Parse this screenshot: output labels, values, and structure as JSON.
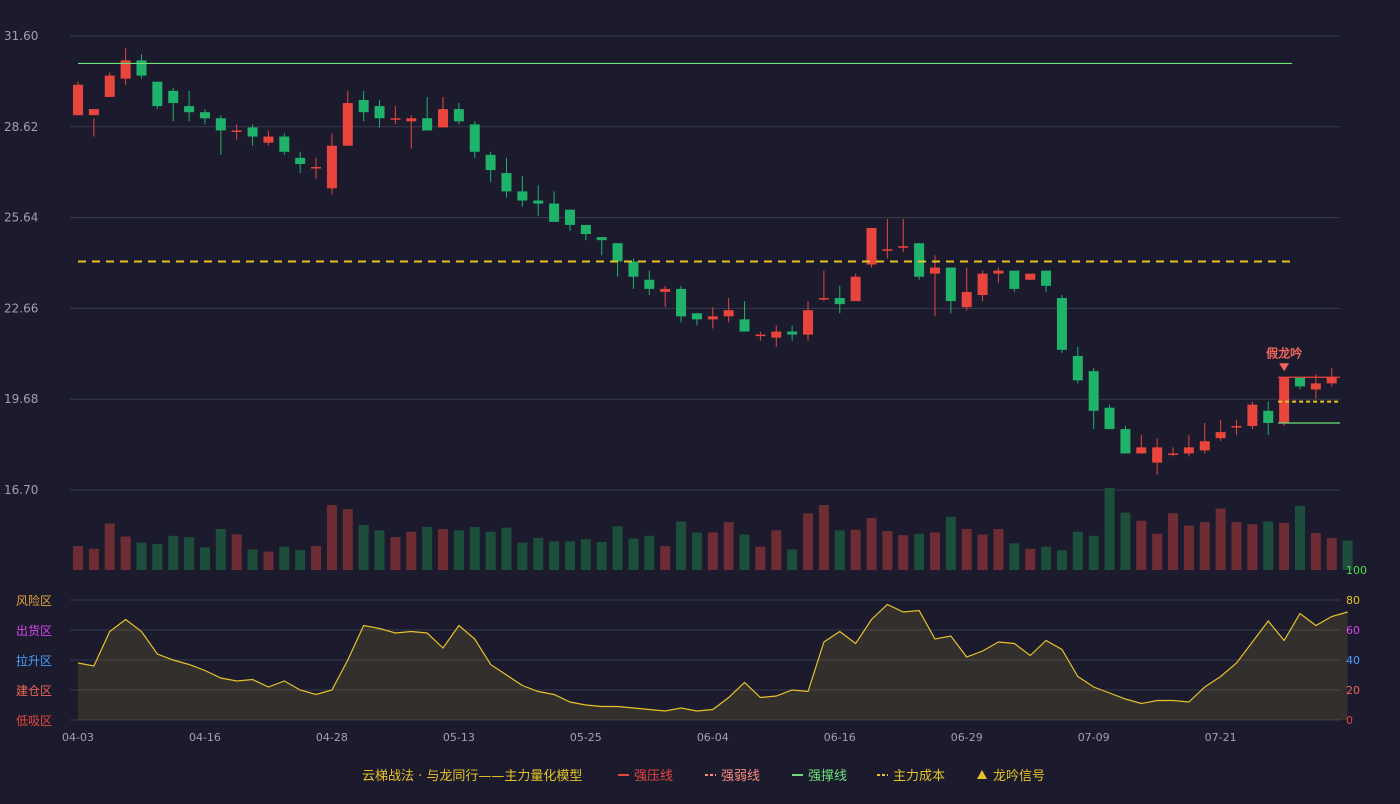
{
  "colors": {
    "background": "#1b1b2d",
    "up": "#e8453c",
    "down": "#1fb26a",
    "grid": "#3a3a4e",
    "axis_text": "#a0a0b0",
    "support_line": "#6ee07a",
    "resist_line": "#e8453c",
    "cost_line": "#e6c229",
    "osc_line": "#e6c229",
    "signal_text": "#f0645a"
  },
  "chart_data": [
    {
      "type": "candlestick",
      "name_ohlc": "price",
      "y_ticks": [
        "31.60",
        "28.62",
        "25.64",
        "22.66",
        "19.68",
        "16.70"
      ],
      "ylim": [
        16.7,
        31.6
      ],
      "x_ticks": [
        {
          "label": "04-03",
          "index": 0
        },
        {
          "label": "04-16",
          "index": 8
        },
        {
          "label": "04-28",
          "index": 16
        },
        {
          "label": "05-13",
          "index": 24
        },
        {
          "label": "05-25",
          "index": 32
        },
        {
          "label": "06-04",
          "index": 40
        },
        {
          "label": "06-16",
          "index": 48
        },
        {
          "label": "06-29",
          "index": 56
        },
        {
          "label": "07-09",
          "index": 64
        },
        {
          "label": "07-21",
          "index": 72
        }
      ],
      "ohlc": [
        [
          29.0,
          30.0,
          29.9,
          30.1
        ],
        [
          29.0,
          29.2,
          28.9,
          28.3
        ],
        [
          29.6,
          30.3,
          30.4,
          29.6
        ],
        [
          30.2,
          30.8,
          31.2,
          30.0
        ],
        [
          30.8,
          30.3,
          31.0,
          30.2
        ],
        [
          30.1,
          29.3,
          30.1,
          29.2
        ],
        [
          29.8,
          29.4,
          29.9,
          28.8
        ],
        [
          29.3,
          29.1,
          29.8,
          28.8
        ],
        [
          29.1,
          28.9,
          29.2,
          28.7
        ],
        [
          28.9,
          28.5,
          29.0,
          27.7
        ],
        [
          28.5,
          28.5,
          28.7,
          28.2
        ],
        [
          28.6,
          28.3,
          28.7,
          28.0
        ],
        [
          28.1,
          28.3,
          28.5,
          28.0
        ],
        [
          28.3,
          27.8,
          28.4,
          27.7
        ],
        [
          27.6,
          27.4,
          27.8,
          27.1
        ],
        [
          27.3,
          27.3,
          27.6,
          26.9
        ],
        [
          26.6,
          28.0,
          28.4,
          26.4
        ],
        [
          28.0,
          29.4,
          29.8,
          28.0
        ],
        [
          29.5,
          29.1,
          29.8,
          28.8
        ],
        [
          29.3,
          28.9,
          29.5,
          28.6
        ],
        [
          28.9,
          28.9,
          29.3,
          28.7
        ],
        [
          28.8,
          28.9,
          29.0,
          27.9
        ],
        [
          28.9,
          28.5,
          29.6,
          28.5
        ],
        [
          28.6,
          29.2,
          29.6,
          28.6
        ],
        [
          29.2,
          28.8,
          29.4,
          28.7
        ],
        [
          28.7,
          27.8,
          28.8,
          27.6
        ],
        [
          27.7,
          27.2,
          27.8,
          26.8
        ],
        [
          27.1,
          26.5,
          27.6,
          26.3
        ],
        [
          26.5,
          26.2,
          27.0,
          26.0
        ],
        [
          26.2,
          26.1,
          26.7,
          25.7
        ],
        [
          26.1,
          25.5,
          26.5,
          25.5
        ],
        [
          25.9,
          25.4,
          25.9,
          25.2
        ],
        [
          25.4,
          25.1,
          25.4,
          24.9
        ],
        [
          25.0,
          24.9,
          25.0,
          24.4
        ],
        [
          24.8,
          24.2,
          24.8,
          23.7
        ],
        [
          24.2,
          23.7,
          24.3,
          23.3
        ],
        [
          23.6,
          23.3,
          23.9,
          23.1
        ],
        [
          23.2,
          23.3,
          23.4,
          22.7
        ],
        [
          23.3,
          22.4,
          23.4,
          22.2
        ],
        [
          22.5,
          22.3,
          22.5,
          22.1
        ],
        [
          22.3,
          22.4,
          22.7,
          22.0
        ],
        [
          22.4,
          22.6,
          23.0,
          22.2
        ],
        [
          22.3,
          21.9,
          22.9,
          21.9
        ],
        [
          21.8,
          21.8,
          21.9,
          21.6
        ],
        [
          21.7,
          21.9,
          22.1,
          21.4
        ],
        [
          21.9,
          21.8,
          22.1,
          21.6
        ],
        [
          21.8,
          22.6,
          22.9,
          21.6
        ],
        [
          23.0,
          23.0,
          23.9,
          22.9
        ],
        [
          23.0,
          22.8,
          23.4,
          22.5
        ],
        [
          22.9,
          23.7,
          23.8,
          22.9
        ],
        [
          24.1,
          25.3,
          25.3,
          24.0
        ],
        [
          24.6,
          24.6,
          25.6,
          24.3
        ],
        [
          24.7,
          24.7,
          25.6,
          24.5
        ],
        [
          24.8,
          23.7,
          24.8,
          23.6
        ],
        [
          23.8,
          24.0,
          24.4,
          22.4
        ],
        [
          24.0,
          22.9,
          24.0,
          22.5
        ],
        [
          22.7,
          23.2,
          24.0,
          22.6
        ],
        [
          23.1,
          23.8,
          23.9,
          22.9
        ],
        [
          23.8,
          23.9,
          24.0,
          23.5
        ],
        [
          23.9,
          23.3,
          23.9,
          23.2
        ],
        [
          23.6,
          23.8,
          23.8,
          23.6
        ],
        [
          23.9,
          23.4,
          23.9,
          23.2
        ],
        [
          23.0,
          21.3,
          23.1,
          21.2
        ],
        [
          21.1,
          20.3,
          21.4,
          20.2
        ],
        [
          20.6,
          19.3,
          20.7,
          18.7
        ],
        [
          19.4,
          18.7,
          19.5,
          18.7
        ],
        [
          18.7,
          17.9,
          18.8,
          17.9
        ],
        [
          17.9,
          18.1,
          18.5,
          17.9
        ],
        [
          17.6,
          18.1,
          18.4,
          17.2
        ],
        [
          17.9,
          17.9,
          18.1,
          17.8
        ],
        [
          17.9,
          18.1,
          18.5,
          17.8
        ],
        [
          18.0,
          18.3,
          18.9,
          17.9
        ],
        [
          18.4,
          18.6,
          19.0,
          18.3
        ],
        [
          18.8,
          18.8,
          19.0,
          18.5
        ],
        [
          18.8,
          19.5,
          19.6,
          18.7
        ],
        [
          19.3,
          18.9,
          19.6,
          18.5
        ],
        [
          18.9,
          20.4,
          20.4,
          18.8
        ],
        [
          20.4,
          20.1,
          20.4,
          20.0
        ],
        [
          20.0,
          20.2,
          20.5,
          19.7
        ],
        [
          20.2,
          20.4,
          20.7,
          20.1
        ]
      ],
      "levels": [
        {
          "kind": "support",
          "value": 30.7,
          "from": 0,
          "to": 76
        },
        {
          "kind": "cost",
          "value": 24.2,
          "from": 0,
          "to": 76,
          "dashed": true
        },
        {
          "kind": "resist",
          "value": 20.4,
          "from": 76,
          "to": 80
        },
        {
          "kind": "cost",
          "value": 19.6,
          "from": 76,
          "to": 80,
          "dashed": true
        },
        {
          "kind": "support",
          "value": 18.9,
          "from": 76,
          "to": 80
        }
      ],
      "signal": {
        "text": "假龙吟",
        "index": 76
      }
    },
    {
      "type": "bar",
      "name_ohlc": "volume",
      "ylim": [
        0,
        100
      ],
      "volumes": [
        35,
        31,
        68,
        49,
        40,
        38,
        50,
        48,
        33,
        60,
        52,
        30,
        27,
        34,
        29,
        35,
        95,
        89,
        66,
        58,
        48,
        56,
        63,
        60,
        58,
        63,
        56,
        62,
        40,
        47,
        42,
        42,
        45,
        41,
        64,
        46,
        50,
        35,
        71,
        55,
        55,
        70,
        52,
        34,
        58,
        30,
        83,
        95,
        58,
        59,
        76,
        57,
        51,
        53,
        55,
        78,
        60,
        52,
        60,
        39,
        31,
        34,
        29,
        56,
        50,
        120,
        84,
        72,
        53,
        83,
        65,
        70,
        90,
        70,
        67,
        71,
        69,
        94,
        54,
        47,
        43
      ]
    },
    {
      "type": "area",
      "name_ohlc": "oscillator",
      "ylim": [
        0,
        100
      ],
      "y_ticks": [
        "100",
        "80",
        "60",
        "40",
        "20",
        "0"
      ],
      "zones": [
        "风险区",
        "出货区",
        "拉升区",
        "建仓区",
        "低吸区"
      ],
      "values": [
        38,
        36,
        59,
        67,
        59,
        44,
        40,
        37,
        33,
        28,
        26,
        27,
        22,
        26,
        20,
        17,
        20,
        40,
        63,
        61,
        58,
        59,
        58,
        48,
        63,
        54,
        37,
        30,
        23,
        19,
        17,
        12,
        10,
        9,
        9,
        8,
        7,
        6,
        8,
        6,
        7,
        15,
        25,
        15,
        16,
        20,
        19,
        52,
        59,
        51,
        67,
        77,
        72,
        73,
        54,
        56,
        42,
        46,
        52,
        51,
        43,
        53,
        47,
        29,
        22,
        18,
        14,
        11,
        13,
        13,
        12,
        22,
        29,
        38,
        52,
        66,
        53,
        71,
        63,
        69,
        72
      ]
    }
  ],
  "legend": {
    "title": "云梯战法 · 与龙同行——主力量化模型",
    "items": [
      {
        "label": "强压线",
        "symbol": "line",
        "color": "#e8453c"
      },
      {
        "label": "强弱线",
        "symbol": "dash",
        "color": "#ff8a80"
      },
      {
        "label": "强撑线",
        "symbol": "line",
        "color": "#6ee07a"
      },
      {
        "label": "主力成本",
        "symbol": "dash",
        "color": "#e6c229"
      },
      {
        "label": "龙吟信号",
        "symbol": "triangle",
        "color": "#e6c229"
      }
    ]
  }
}
